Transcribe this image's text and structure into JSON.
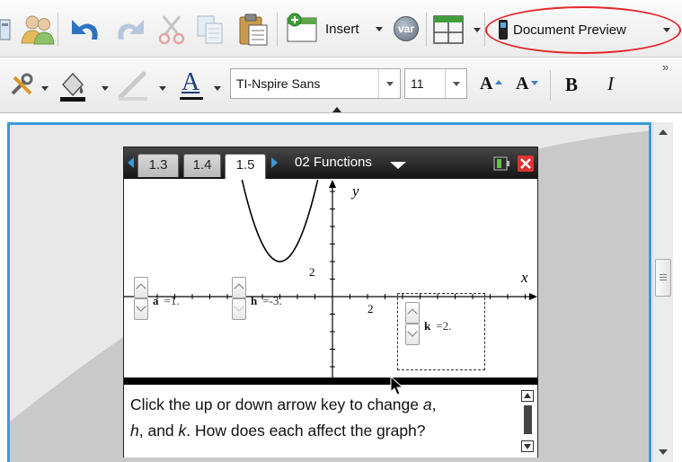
{
  "toolbar": {
    "insert_label": "Insert",
    "var_label": "var",
    "document_preview_label": "Document Preview",
    "font_name": "TI-Nspire Sans",
    "font_size": "11",
    "increase_font_label": "A",
    "decrease_font_label": "A",
    "bold_label": "B",
    "italic_label": "I",
    "overflow_label": "»",
    "annotation_color": "#e4262a"
  },
  "handheld": {
    "tabs": [
      {
        "label": "1.3"
      },
      {
        "label": "1.4"
      },
      {
        "label": "1.5"
      }
    ],
    "active_tab": "1.5",
    "document_title": "02 Functions",
    "frame_color": "#3b9ad8"
  },
  "graph": {
    "y_axis_label": "y",
    "x_axis_label": "x",
    "y_tick_label": "2",
    "x_tick_label": "2",
    "function": "y = a(x - h)^2 + k",
    "sliders": [
      {
        "name": "a",
        "value": "=1.",
        "num": 1
      },
      {
        "name": "h",
        "value": "=-3.",
        "num": -3
      },
      {
        "name": "k",
        "value": "=2.",
        "num": 2
      }
    ]
  },
  "notes": {
    "line1_a": "Click the up or down arrow key to change ",
    "line1_var": "a",
    "line1_b": ",",
    "line2_var1": "h",
    "line2_a": ", and ",
    "line2_var2": "k",
    "line2_b": ". How does each affect the graph?"
  }
}
